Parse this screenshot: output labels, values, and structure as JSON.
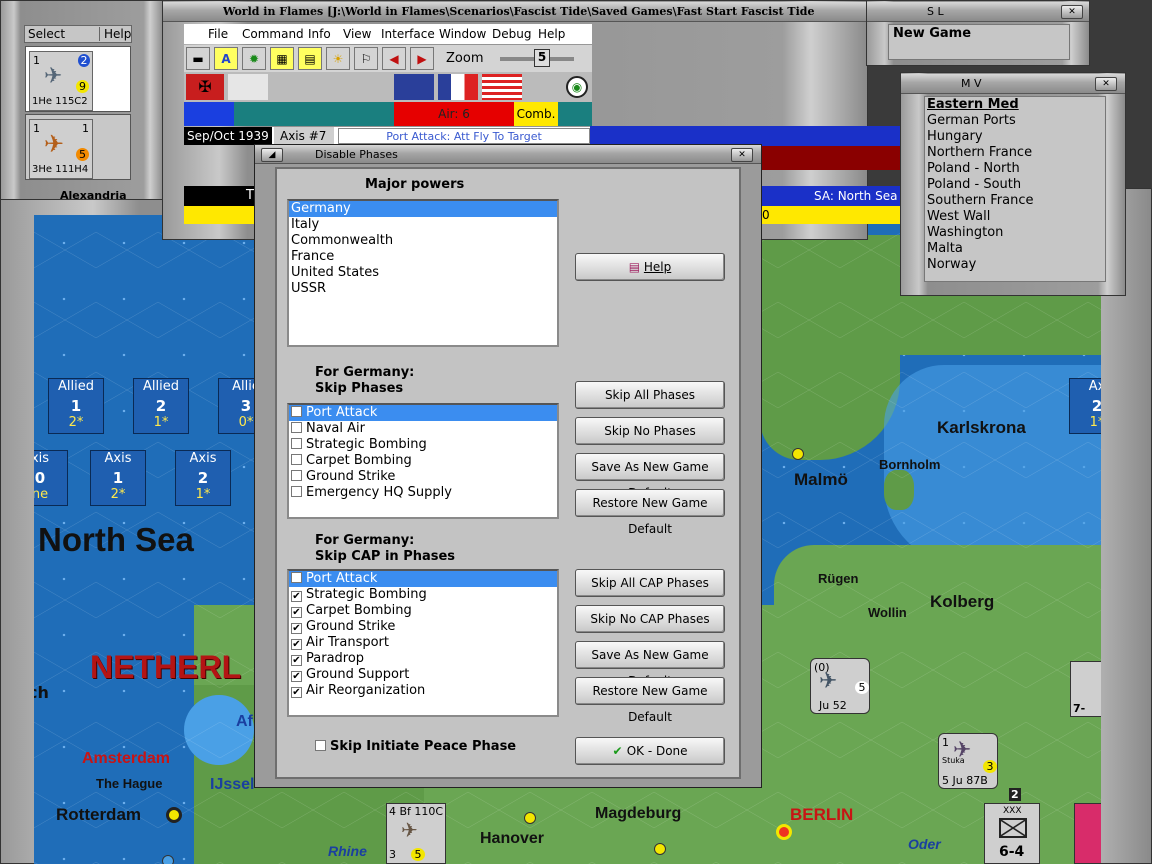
{
  "main_window": {
    "title": "World in Flames [J:\\World in Flames\\Scenarios\\Fascist Tide\\Saved Games\\Fast Start Fascist Tide",
    "menu": [
      "File",
      "Command",
      "Info",
      "View",
      "Interface",
      "Window",
      "Debug",
      "Help"
    ],
    "zoom_label": "Zoom",
    "zoom_value": "5",
    "air_label": "Air: 6",
    "comb_label": "Comb.",
    "date": "Sep/Oct 1939",
    "turn": "Axis #7",
    "phase": "Port Attack: Att Fly To Target",
    "sa_label": "SA: North Sea",
    "t_label": "T",
    "zero": "0"
  },
  "select_window": {
    "tab_select": "Select",
    "tab_help": "Help",
    "units": [
      {
        "badge": "9",
        "top_num": "1",
        "top_right": "2",
        "bottom": "1He 115C2"
      },
      {
        "badge": "5",
        "top_num": "1",
        "top_right": "1",
        "bottom": "3He 111H4"
      }
    ],
    "alexandria": "Alexandria"
  },
  "sl_window": {
    "title": "S L",
    "item": "New Game"
  },
  "mv_window": {
    "title": "M V",
    "items": [
      "Eastern Med",
      "German Ports",
      "Hungary",
      "Northern France",
      "Poland - North",
      "Poland - South",
      "Southern France",
      "West Wall",
      "Washington",
      "Malta",
      "Norway"
    ]
  },
  "map": {
    "boxes": [
      {
        "label": "Allied",
        "num": "1",
        "star": "2*"
      },
      {
        "label": "Allied",
        "num": "2",
        "star": "1*"
      },
      {
        "label": "Allie",
        "num": "3",
        "star": "0*"
      },
      {
        "label": "xis",
        "num": "0",
        "star": "ne"
      },
      {
        "label": "Axis",
        "num": "1",
        "star": "2*"
      },
      {
        "label": "Axis",
        "num": "2",
        "star": "1*"
      },
      {
        "label": "Ax",
        "num": "2",
        "star": "1*"
      }
    ],
    "sea": "North Sea",
    "country": "NETHERL",
    "ch": "ch",
    "cities": {
      "karlskrona": "Karlskrona",
      "malmo": "Malmö",
      "bornholm": "Bornholm",
      "rugen": "Rügen",
      "wollin": "Wollin",
      "kolberg": "Kolberg",
      "amsterdam": "Amsterdam",
      "hague": "The Hague",
      "rotterdam": "Rotterdam",
      "ijssel": "IJssel",
      "af": "Af",
      "hanover": "Hanover",
      "magdeburg": "Magdeburg",
      "berlin": "BERLIN",
      "rhine": "Rhine",
      "oder": "Oder"
    },
    "units": {
      "ju52": "Ju 52",
      "ju52_top": "(0)",
      "ju52_val": "5",
      "stuka": "Stuka",
      "ju87": "5 Ju 87B",
      "ju87_top": "1",
      "ju87_val": "3",
      "bf110": "4 Bf 110C",
      "bf110_b": "3",
      "bf110_val": "5",
      "corps": "6-4",
      "corps_top": "XXX",
      "corps_n": "2",
      "seven": "7-"
    }
  },
  "dialog": {
    "title": "Disable Phases",
    "major_powers_label": "Major powers",
    "powers": [
      "Germany",
      "Italy",
      "Commonwealth",
      "France",
      "United States",
      "USSR"
    ],
    "help_button": "Help",
    "skip_label_1": "For Germany:",
    "skip_label_2": "Skip Phases",
    "skip_phases": [
      {
        "label": "Port Attack",
        "checked": false
      },
      {
        "label": "Naval Air",
        "checked": false
      },
      {
        "label": "Strategic Bombing",
        "checked": false
      },
      {
        "label": "Carpet Bombing",
        "checked": false
      },
      {
        "label": "Ground Strike",
        "checked": false
      },
      {
        "label": "Emergency HQ Supply",
        "checked": false
      }
    ],
    "skip_all": "Skip All Phases",
    "skip_no": "Skip No Phases",
    "save_default": "Save As New Game Default",
    "restore_default": "Restore New Game Default",
    "cap_label_1": "For Germany:",
    "cap_label_2": "Skip CAP in Phases",
    "cap_phases": [
      {
        "label": "Port Attack",
        "checked": false
      },
      {
        "label": "Strategic Bombing",
        "checked": true
      },
      {
        "label": "Carpet Bombing",
        "checked": true
      },
      {
        "label": "Ground Strike",
        "checked": true
      },
      {
        "label": "Air Transport",
        "checked": true
      },
      {
        "label": "Paradrop",
        "checked": true
      },
      {
        "label": "Ground Support",
        "checked": true
      },
      {
        "label": "Air Reorganization",
        "checked": true
      }
    ],
    "skip_all_cap": "Skip All CAP Phases",
    "skip_no_cap": "Skip No CAP Phases",
    "save_default_2": "Save As New Game Default",
    "restore_default_2": "Restore New Game Default",
    "peace_label": "Skip Initiate Peace Phase",
    "ok_button": "OK - Done"
  }
}
